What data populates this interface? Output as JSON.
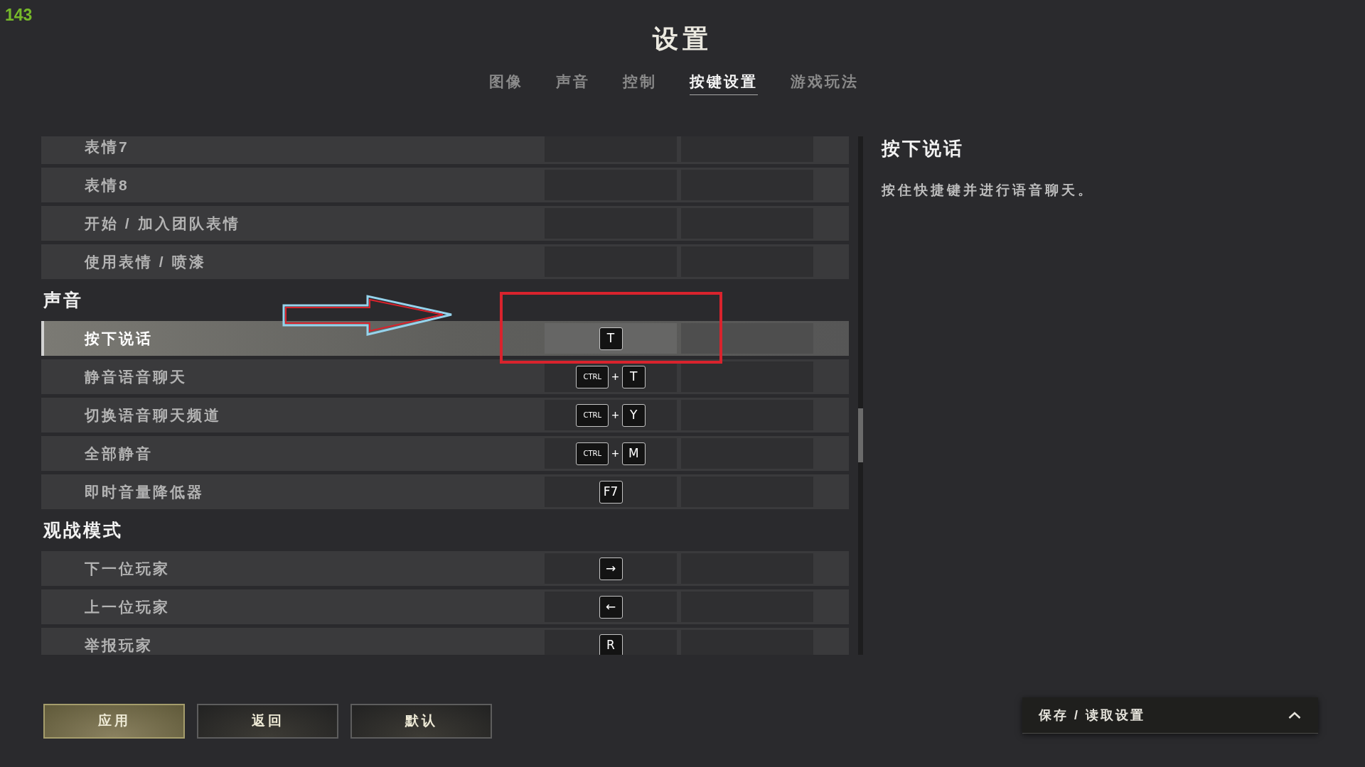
{
  "fps_counter": "143",
  "title": "设置",
  "tabs": [
    {
      "label": "图像",
      "selected": false
    },
    {
      "label": "声音",
      "selected": false
    },
    {
      "label": "控制",
      "selected": false
    },
    {
      "label": "按键设置",
      "selected": true
    },
    {
      "label": "游戏玩法",
      "selected": false
    }
  ],
  "list": [
    {
      "kind": "row",
      "label": "表情7",
      "selected": false
    },
    {
      "kind": "row",
      "label": "表情8",
      "selected": false
    },
    {
      "kind": "row",
      "label": "开始 / 加入团队表情",
      "selected": false
    },
    {
      "kind": "row",
      "label": "使用表情 / 喷漆",
      "selected": false
    },
    {
      "kind": "header",
      "label": "声音"
    },
    {
      "kind": "row",
      "label": "按下说话",
      "selected": true,
      "keys": [
        {
          "kind": "key",
          "label": "T"
        }
      ]
    },
    {
      "kind": "row",
      "label": "静音语音聊天",
      "selected": false,
      "keys": [
        {
          "kind": "modifier",
          "label": "CTRL"
        },
        {
          "kind": "plus",
          "label": "+"
        },
        {
          "kind": "key",
          "label": "T"
        }
      ]
    },
    {
      "kind": "row",
      "label": "切换语音聊天频道",
      "selected": false,
      "keys": [
        {
          "kind": "modifier",
          "label": "CTRL"
        },
        {
          "kind": "plus",
          "label": "+"
        },
        {
          "kind": "key",
          "label": "Y"
        }
      ]
    },
    {
      "kind": "row",
      "label": "全部静音",
      "selected": false,
      "keys": [
        {
          "kind": "modifier",
          "label": "CTRL"
        },
        {
          "kind": "plus",
          "label": "+"
        },
        {
          "kind": "key",
          "label": "M"
        }
      ]
    },
    {
      "kind": "row",
      "label": "即时音量降低器",
      "selected": false,
      "keys": [
        {
          "kind": "key",
          "label": "F7"
        }
      ]
    },
    {
      "kind": "header",
      "label": "观战模式"
    },
    {
      "kind": "row",
      "label": "下一位玩家",
      "selected": false,
      "keys": [
        {
          "kind": "key",
          "label": "→"
        }
      ]
    },
    {
      "kind": "row",
      "label": "上一位玩家",
      "selected": false,
      "keys": [
        {
          "kind": "key",
          "label": "←"
        }
      ]
    },
    {
      "kind": "row",
      "label": "举报玩家",
      "selected": false,
      "keys": [
        {
          "kind": "key",
          "label": "R"
        }
      ]
    }
  ],
  "detail": {
    "title": "按下说话",
    "description": "按住快捷键并进行语音聊天。"
  },
  "buttons": [
    {
      "kind": "primary",
      "label": "应用"
    },
    {
      "kind": "secondary",
      "label": "返回"
    },
    {
      "kind": "secondary",
      "label": "默认"
    }
  ],
  "preset_menu": {
    "label": "保存 / 读取设置",
    "expanded": false
  }
}
